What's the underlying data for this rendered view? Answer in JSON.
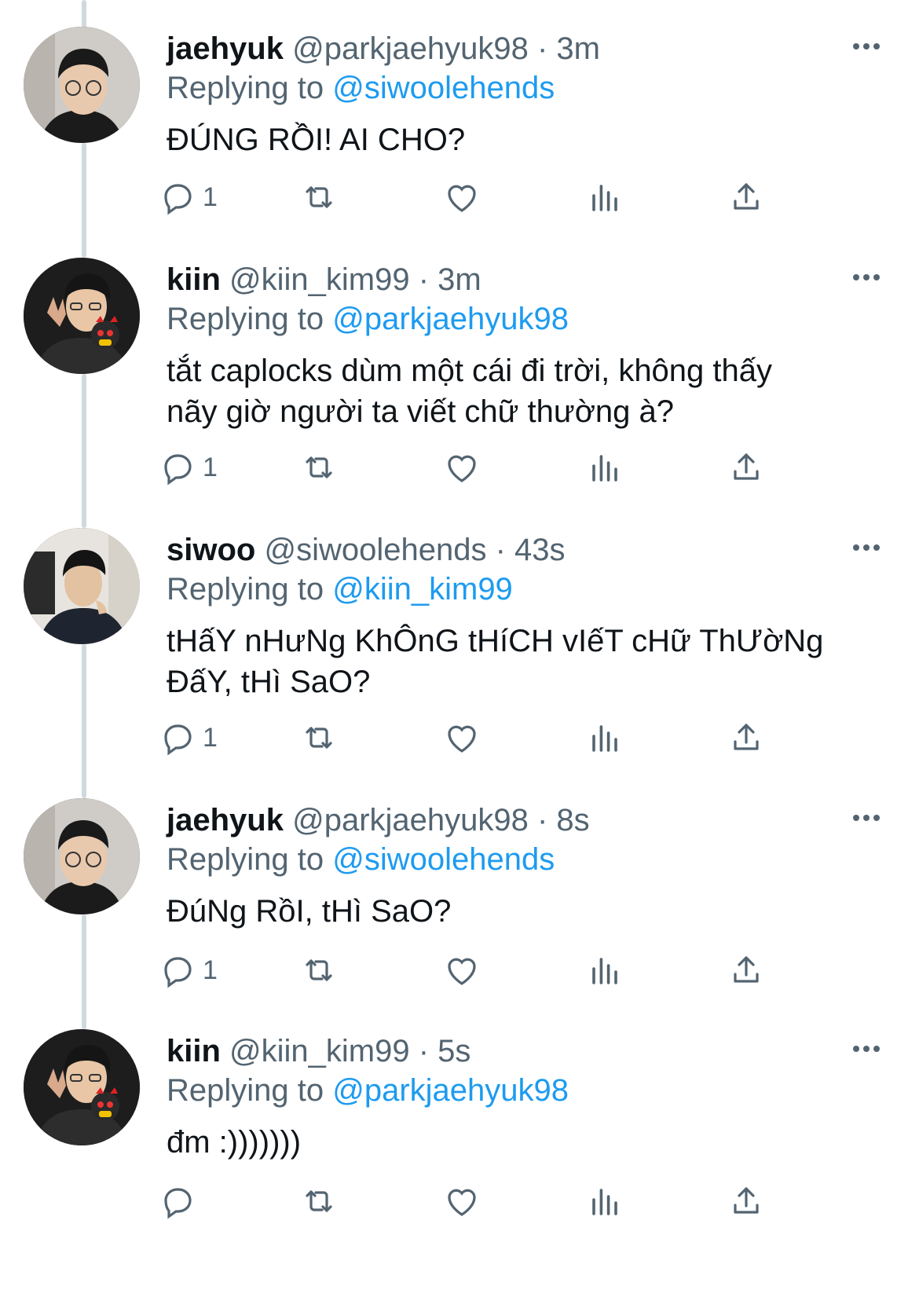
{
  "tweets": [
    {
      "name": "jaehyuk",
      "handle": "@parkjaehyuk98",
      "dot": " · ",
      "time": "3m",
      "replying_label": "Replying to ",
      "mention": "@siwoolehends",
      "text": "ĐÚNG RỒI! AI CHO?",
      "reply_count": "1",
      "avatar": "avatar-jaehyuk"
    },
    {
      "name": "kiin",
      "handle": "@kiin_kim99",
      "dot": " · ",
      "time": "3m",
      "replying_label": "Replying to ",
      "mention": "@parkjaehyuk98",
      "text": "tắt caplocks dùm một cái đi trời, không thấy\nnãy giờ người ta viết chữ thường à?",
      "reply_count": "1",
      "avatar": "avatar-kiin"
    },
    {
      "name": "siwoo",
      "handle": "@siwoolehends",
      "dot": " · ",
      "time": "43s",
      "replying_label": "Replying to ",
      "mention": "@kiin_kim99",
      "text": "tHấY nHưNg KhÔnG tHíCH vIếT cHữ ThƯờNg\nĐấY, tHì SaO?",
      "reply_count": "1",
      "avatar": "avatar-siwoo"
    },
    {
      "name": "jaehyuk",
      "handle": "@parkjaehyuk98",
      "dot": " · ",
      "time": "8s",
      "replying_label": "Replying to ",
      "mention": "@siwoolehends",
      "text": "ĐúNg RồI, tHì SaO?",
      "reply_count": "1",
      "avatar": "avatar-jaehyuk"
    },
    {
      "name": "kiin",
      "handle": "@kiin_kim99",
      "dot": " · ",
      "time": "5s",
      "replying_label": "Replying to ",
      "mention": "@parkjaehyuk98",
      "text": "đm :)))))))",
      "reply_count": "",
      "avatar": "avatar-kiin"
    }
  ],
  "colors": {
    "accent": "#1d9bf0",
    "muted": "#536471",
    "text": "#0f1419",
    "thread_line": "#cfd9de"
  },
  "icons": {
    "reply": "reply-icon",
    "retweet": "retweet-icon",
    "like": "heart-icon",
    "views": "analytics-icon",
    "share": "share-icon",
    "more": "more-icon"
  }
}
